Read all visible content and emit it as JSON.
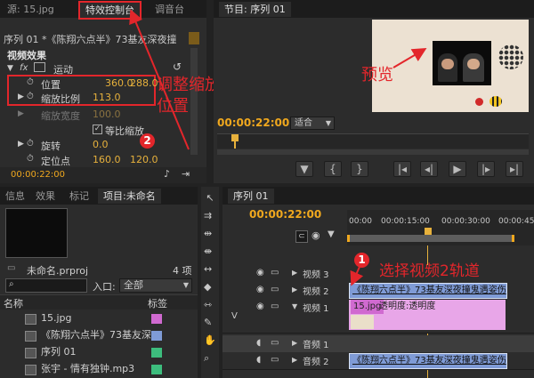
{
  "effect_controls": {
    "tabs": [
      "源: 15.jpg",
      "特效控制台",
      "调音台"
    ],
    "sequence_path": "序列 01 *《陈翔六点半》73基友深夜撞",
    "section": "视频效果",
    "motion_label": "运动",
    "fx_label": "fx",
    "position_label": "位置",
    "position_x": "360.0",
    "position_y": "288.0",
    "scale_label": "缩放比例",
    "scale_value": "113.0",
    "scale_width_label": "缩放宽度",
    "scale_width_value": "100.0",
    "uniform_scale_label": "等比缩放",
    "rotation_label": "旋转",
    "rotation_value": "0.0",
    "anchor_label": "定位点",
    "anchor_x": "160.0",
    "anchor_y": "120.0",
    "timecode": "00:00:22:00"
  },
  "annotations": {
    "scale_note": "调整缩放比例和位置",
    "preview_note": "预览",
    "track_note": "选择视频2轨道",
    "badge1": "1",
    "badge2": "2"
  },
  "program": {
    "tabs": [
      "节目: 序列 01"
    ],
    "timecode": "00:00:22:00",
    "fit_label": "适合"
  },
  "project": {
    "tabs": [
      "信息",
      "效果",
      "标记",
      "项目:未命名"
    ],
    "project_file": "未命名.prproj",
    "item_count": "4 项",
    "in_label": "入口:",
    "in_value": "全部",
    "col_name": "名称",
    "col_label": "标签",
    "items": [
      {
        "name": "15.jpg",
        "color": "#d06ad0",
        "icon": "image-icon"
      },
      {
        "name": "《陈翔六点半》73基友深",
        "color": "#7f9bd6",
        "icon": "video-clip-icon"
      },
      {
        "name": "序列 01",
        "color": "#3dbd7d",
        "icon": "sequence-icon"
      },
      {
        "name": "张宇 - 情有独钟.mp3",
        "color": "#3dbd7d",
        "icon": "audio-clip-icon"
      }
    ]
  },
  "timeline": {
    "tab": "序列 01",
    "timecode": "00:00:22:00",
    "ruler": [
      "00:00",
      "00:00:15:00",
      "00:00:30:00",
      "00:00:45:00"
    ],
    "tracks": [
      {
        "name": "视频 3"
      },
      {
        "name": "视频 2",
        "clip": "《陈翔六点半》73基友深夜撞鬼遇姿伤"
      },
      {
        "name": "视频 1",
        "clip": "15.jpg",
        "clip_sub": "透明度:透明度"
      },
      {
        "name": "音频 1"
      },
      {
        "name": "音频 2",
        "clip": "《陈翔六点半》73基友深夜撞鬼遇姿伤"
      }
    ],
    "v_label": "V"
  },
  "colors": {
    "accent": "#f0a81e",
    "annotation": "#e3262b",
    "clip_blue": "#7f9bd6",
    "clip_pink": "#e8a6e8"
  }
}
